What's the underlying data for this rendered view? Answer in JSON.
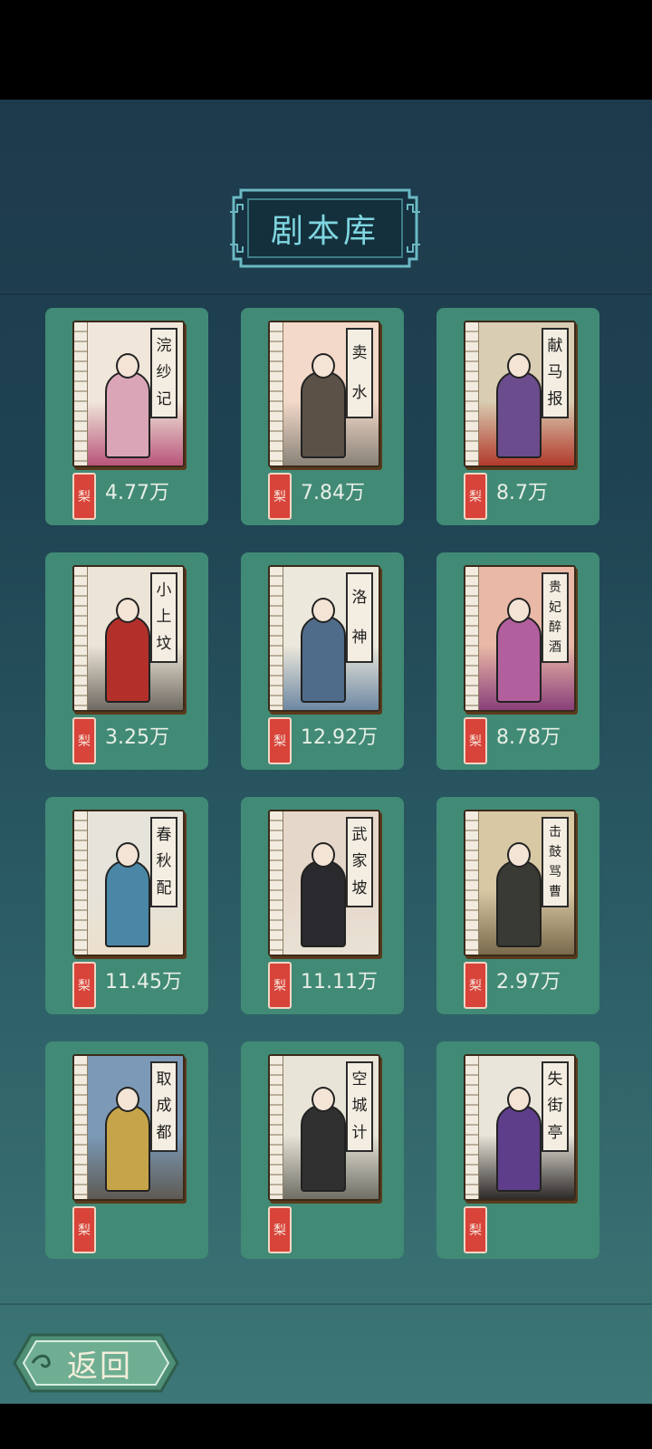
{
  "header": {
    "title": "剧本库"
  },
  "colors": {
    "card": "#418a76",
    "title_text": "#7fd6e0",
    "stamp": "#d8433a"
  },
  "scripts": [
    {
      "title_chars": [
        "浣",
        "纱",
        "记"
      ],
      "count": "4.77万",
      "palette": [
        "#f0e7da",
        "#dba5b8",
        "#b9557a"
      ]
    },
    {
      "title_chars": [
        "卖",
        "水"
      ],
      "count": "7.84万",
      "palette": [
        "#f3d9c9",
        "#5b5146",
        "#8a8378"
      ]
    },
    {
      "title_chars": [
        "献",
        "马",
        "报"
      ],
      "count": "8.7万",
      "palette": [
        "#d9cdb3",
        "#6b4c8c",
        "#b23a2b"
      ]
    },
    {
      "title_chars": [
        "小",
        "上",
        "坟"
      ],
      "count": "3.25万",
      "palette": [
        "#ece4d6",
        "#b3302a",
        "#6f6a62"
      ]
    },
    {
      "title_chars": [
        "洛",
        "神"
      ],
      "count": "12.92万",
      "palette": [
        "#ece8dc",
        "#4f6c8a",
        "#6d88a3"
      ]
    },
    {
      "title_chars": [
        "贵",
        "妃",
        "醉",
        "酒"
      ],
      "count": "8.78万",
      "palette": [
        "#e9b8a6",
        "#b25f9d",
        "#8a3f7a"
      ]
    },
    {
      "title_chars": [
        "春",
        "秋",
        "配"
      ],
      "count": "11.45万",
      "palette": [
        "#e5e3da",
        "#4a87a6",
        "#ece0cc"
      ]
    },
    {
      "title_chars": [
        "武",
        "家",
        "坡"
      ],
      "count": "11.11万",
      "palette": [
        "#e6d7cb",
        "#2a2a2e",
        "#e8e2d4"
      ]
    },
    {
      "title_chars": [
        "击",
        "鼓",
        "骂",
        "曹"
      ],
      "count": "2.97万",
      "palette": [
        "#d8c8a4",
        "#3a3a34",
        "#7a6a4c"
      ]
    },
    {
      "title_chars": [
        "取",
        "成",
        "都"
      ],
      "count": "",
      "palette": [
        "#7c9ab7",
        "#c6a44a",
        "#5e5a54"
      ]
    },
    {
      "title_chars": [
        "空",
        "城",
        "计"
      ],
      "count": "",
      "palette": [
        "#e8e4d8",
        "#2f302f",
        "#6f6f66"
      ]
    },
    {
      "title_chars": [
        "失",
        "街",
        "亭"
      ],
      "count": "",
      "palette": [
        "#e9e5da",
        "#5e3d8a",
        "#2d2a2a"
      ]
    }
  ],
  "stamp_char": "梨",
  "footer": {
    "back_label": "返回"
  }
}
